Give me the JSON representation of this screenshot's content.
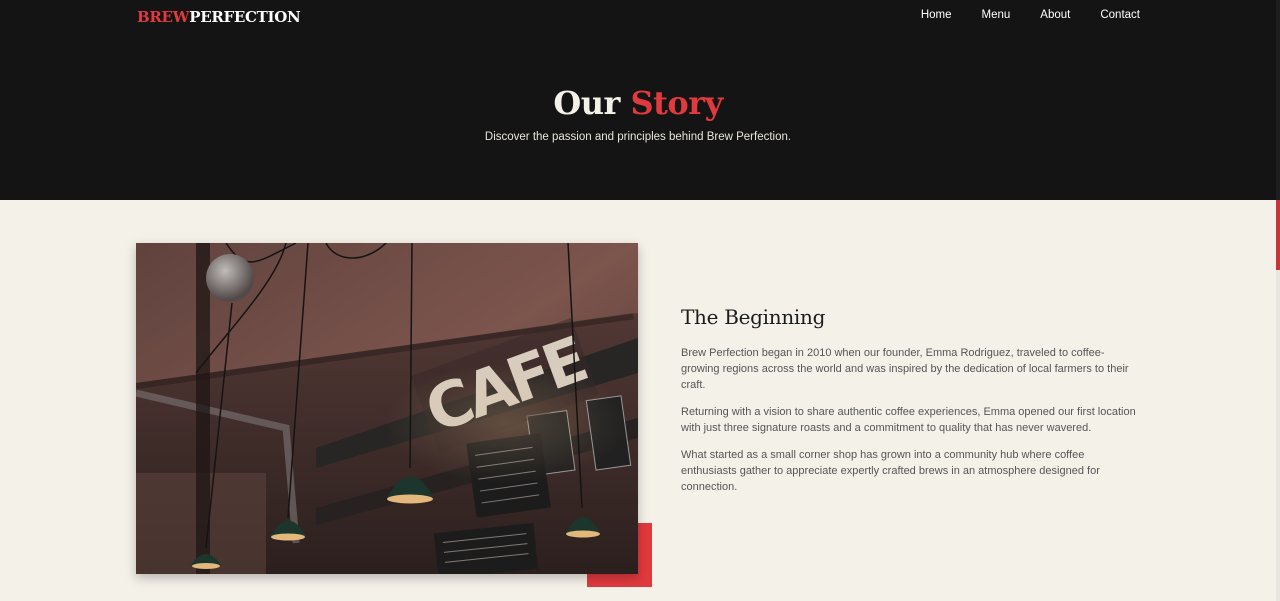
{
  "brand": {
    "part1": "BREW",
    "part2": "PERFECTION"
  },
  "nav": [
    {
      "label": "Home"
    },
    {
      "label": "Menu"
    },
    {
      "label": "About"
    },
    {
      "label": "Contact"
    }
  ],
  "hero": {
    "title_part1": "Our ",
    "title_part2": "Story",
    "subtitle": "Discover the passion and principles behind Brew Perfection."
  },
  "story": {
    "heading": "The Beginning",
    "paragraphs": [
      "Brew Perfection began in 2010 when our founder, Emma Rodriguez, traveled to coffee-growing regions across the world and was inspired by the dedication of local farmers to their craft.",
      "Returning with a vision to share authentic coffee experiences, Emma opened our first location with just three signature roasts and a commitment to quality that has never wavered.",
      "What started as a small corner shop has grown into a community hub where coffee enthusiasts gather to appreciate expertly crafted brews in an atmosphere designed for connection."
    ]
  },
  "photo": {
    "sign_text": "CAFE"
  },
  "colors": {
    "accent": "#e03a3e",
    "header_bg": "#141414",
    "page_bg": "#f4f1e9"
  }
}
